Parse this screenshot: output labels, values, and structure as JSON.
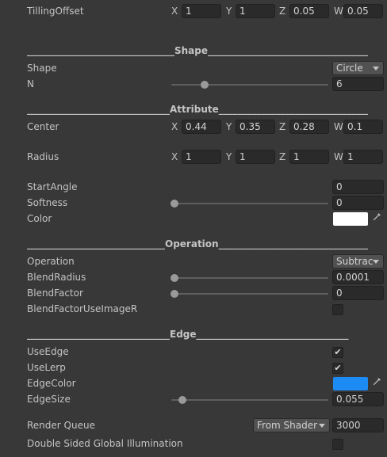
{
  "tilling_offset": {
    "label": "TillingOffset",
    "x_axis": "X",
    "x": "1",
    "y_axis": "Y",
    "y": "1",
    "z_axis": "Z",
    "z": "0.05",
    "w_axis": "W",
    "w": "0.05"
  },
  "sections": {
    "shape": "_______________________________Shape______________________________________",
    "attribute": "______________________________Attribute______________________________________",
    "operation": "_____________________________Operation______________________________________",
    "edge": "______________________________Edge________________________________"
  },
  "shape": {
    "label": "Shape",
    "value": "Circle"
  },
  "n": {
    "label": "N",
    "value": "6",
    "slider_fraction": 0.22
  },
  "center": {
    "label": "Center",
    "x_axis": "X",
    "x": "0.44",
    "y_axis": "Y",
    "y": "0.35",
    "z_axis": "Z",
    "z": "0.28",
    "w_axis": "W",
    "w": "0.1"
  },
  "radius": {
    "label": "Radius",
    "x_axis": "X",
    "x": "1",
    "y_axis": "Y",
    "y": "1",
    "z_axis": "Z",
    "z": "1",
    "w_axis": "W",
    "w": "1"
  },
  "start_angle": {
    "label": "StartAngle",
    "value": "0"
  },
  "softness": {
    "label": "Softness",
    "value": "0",
    "slider_fraction": 0.0
  },
  "color": {
    "label": "Color",
    "swatch": "#ffffff",
    "picker_icon": "eyedropper-icon"
  },
  "operation": {
    "label": "Operation",
    "value": "Subtrac"
  },
  "blend_radius": {
    "label": "BlendRadius",
    "value": "0.0001",
    "slider_fraction": 0.0
  },
  "blend_factor": {
    "label": "BlendFactor",
    "value": "0",
    "slider_fraction": 0.0
  },
  "blend_factor_use_image": {
    "label": "BlendFactorUseImageR",
    "checked": false
  },
  "use_edge": {
    "label": "UseEdge",
    "checked": true,
    "mark": "✔"
  },
  "use_lerp": {
    "label": "UseLerp",
    "checked": true,
    "mark": "✔"
  },
  "edge_color": {
    "label": "EdgeColor",
    "swatch": "#1c8bf4",
    "picker_icon": "eyedropper-icon"
  },
  "edge_size": {
    "label": "EdgeSize",
    "value": "0.055",
    "slider_fraction": 0.055
  },
  "render_queue": {
    "label": "Render Queue",
    "mode": "From Shader",
    "value": "3000"
  },
  "double_sided_gi": {
    "label": "Double Sided Global Illumination",
    "checked": false
  }
}
